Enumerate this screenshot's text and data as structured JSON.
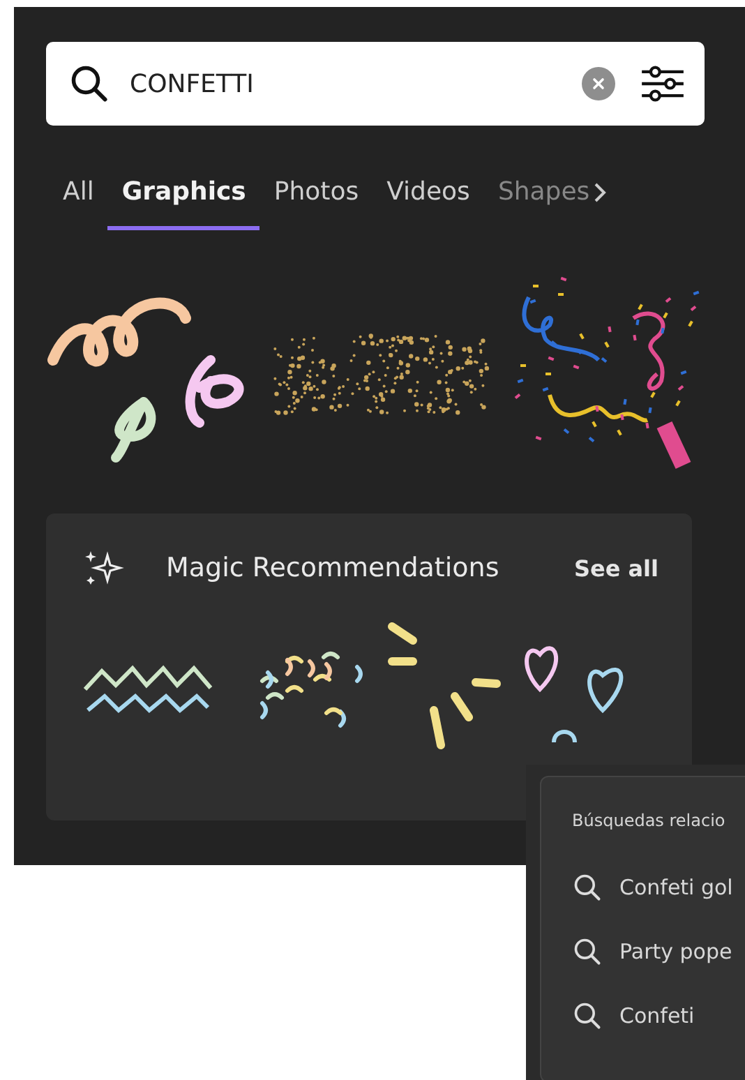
{
  "search": {
    "value": "CONFETTI"
  },
  "tabs": [
    {
      "label": "All",
      "selected": false
    },
    {
      "label": "Graphics",
      "selected": true
    },
    {
      "label": "Photos",
      "selected": false
    },
    {
      "label": "Videos",
      "selected": false
    },
    {
      "label": "Shapes",
      "selected": false
    }
  ],
  "magic": {
    "title": "Magic Recommendations",
    "see_all": "See all"
  },
  "related": {
    "heading": "Búsquedas relacio",
    "items": [
      "Confeti gol",
      "Party pope",
      "Confeti"
    ]
  }
}
